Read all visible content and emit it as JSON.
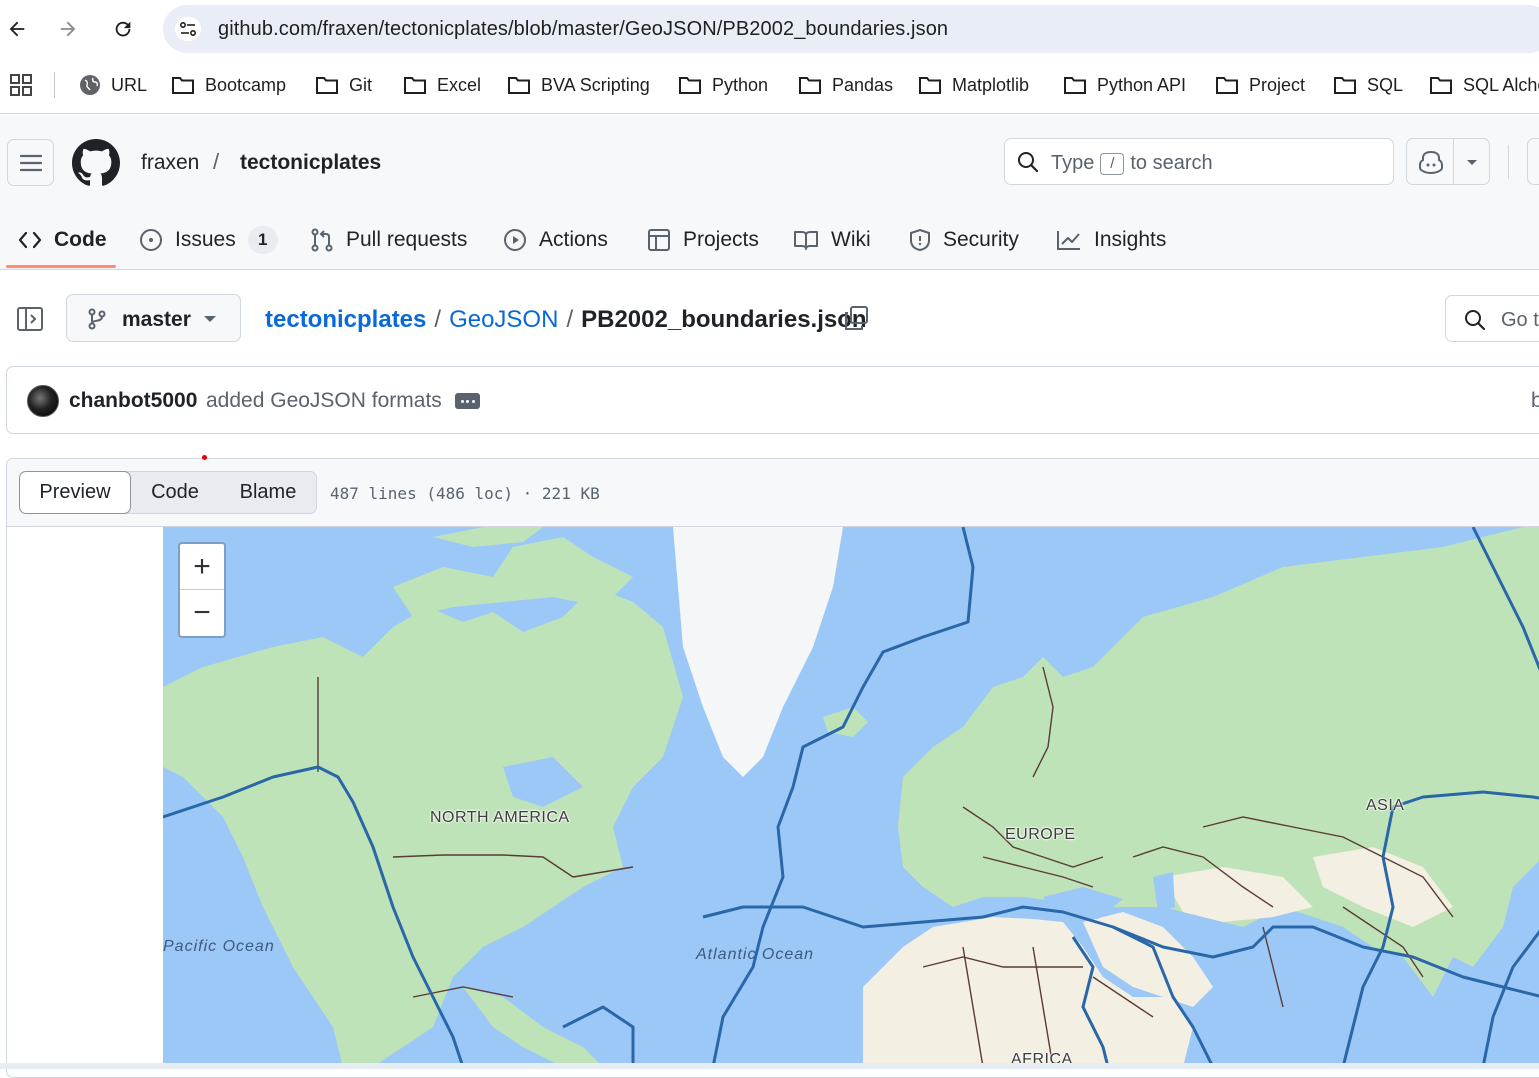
{
  "browser": {
    "url": "github.com/fraxen/tectonicplates/blob/master/GeoJSON/PB2002_boundaries.json",
    "bookmarks": [
      "URL",
      "Bootcamp",
      "Git",
      "Excel",
      "BVA Scripting",
      "Python",
      "Pandas",
      "Matplotlib",
      "Python API",
      "Project",
      "SQL",
      "SQL Alche"
    ]
  },
  "repo": {
    "owner": "fraxen",
    "slash": "/",
    "name": "tectonicplates"
  },
  "search": {
    "prefix": "Type",
    "key": "/",
    "suffix": "to search"
  },
  "tabs": [
    {
      "label": "Code"
    },
    {
      "label": "Issues",
      "count": "1"
    },
    {
      "label": "Pull requests"
    },
    {
      "label": "Actions"
    },
    {
      "label": "Projects"
    },
    {
      "label": "Wiki"
    },
    {
      "label": "Security"
    },
    {
      "label": "Insights"
    }
  ],
  "branch": "master",
  "breadcrumb": {
    "repo": "tectonicplates",
    "folder": "GeoJSON",
    "file": "PB2002_boundaries.json",
    "sep": "/"
  },
  "goto": "Go t",
  "commit": {
    "user": "chanbot5000",
    "message": "added GeoJSON formats",
    "right": "b"
  },
  "file": {
    "views": [
      "Preview",
      "Code",
      "Blame"
    ],
    "active_view": "Preview",
    "meta": "487 lines (486 loc) · 221 KB"
  },
  "map": {
    "zoom_in": "+",
    "zoom_out": "−",
    "labels": {
      "north_america": "NORTH AMERICA",
      "europe": "EUROPE",
      "asia": "ASIA",
      "africa": "AFRICA",
      "pacific": "Pacific Ocean",
      "atlantic": "Atlantic Ocean"
    },
    "colors": {
      "water": "#9cc8f7",
      "land_green": "#bfe3b8",
      "land_sand": "#f3efe2",
      "plate_boundary": "#2a67a8",
      "country_border": "#5b3b36"
    }
  },
  "colors": {
    "link": "#0969da",
    "active_tab_underline": "#fd8c73"
  }
}
